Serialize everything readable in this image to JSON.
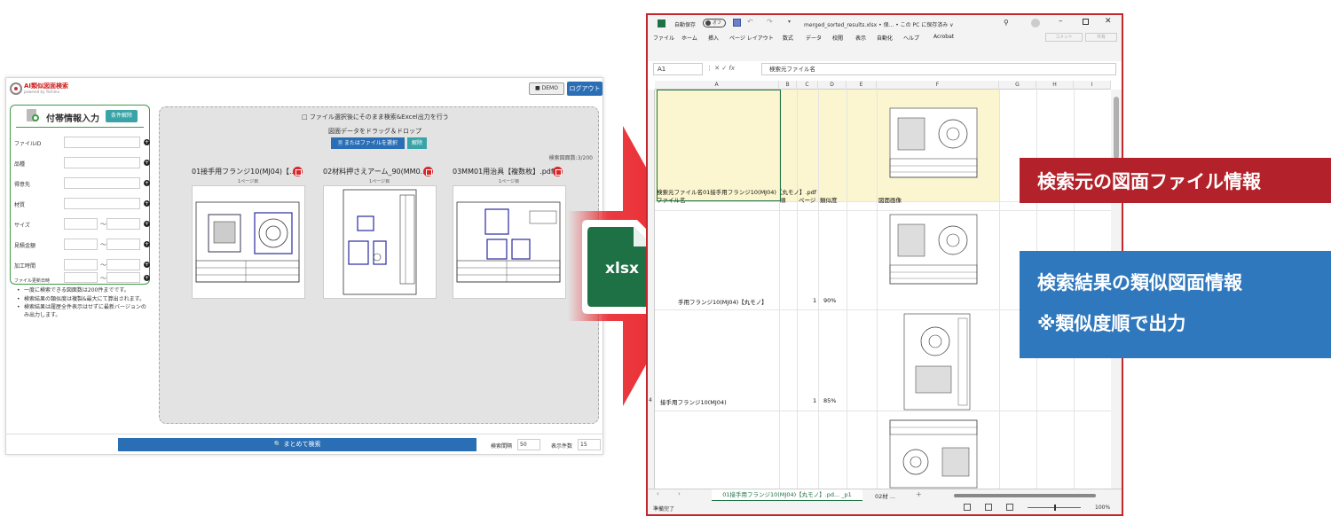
{
  "app": {
    "title": "AI類似図面検索",
    "subtitle": "powered by Techmo",
    "demo_label": "DEMO",
    "logout_label": "ログアウト"
  },
  "side": {
    "title": "付帯情報入力",
    "reset_label": "条件解除",
    "fields": [
      "ファイルID",
      "品種",
      "得意先",
      "材質",
      "サイズ",
      "見積金額",
      "加工時間",
      "ファイル更新日時"
    ],
    "range_tilde": "〜"
  },
  "notes": [
    "一度に検索できる図面数は200件までです。",
    "検索結果の類似度は複製&最大にて算出されます。",
    "検索結果は履歴全件表示はせずに最新バージョンのみ出力します。"
  ],
  "drop": {
    "auto_check_label": "ファイル選択後にそのまま検索&Excel出力を行う",
    "drop_text": "図面データをドラッグ＆ドロップ",
    "select_label": "またはファイルを選択",
    "clear_label": "解除",
    "count_text": "検索図面数:3/200",
    "page_label": "1ページ目",
    "cards": [
      {
        "title": "01接手用フランジ10(MJ04)【..."
      },
      {
        "title": "02材料押さえアーム_90(MM0..."
      },
      {
        "title": "03MM01用治具【複数枚】.pdf"
      }
    ]
  },
  "bottom": {
    "search_all_label": "まとめて検索",
    "interval_label": "検索間隔",
    "interval_value": "50",
    "display_label": "表示件数",
    "display_value": "15"
  },
  "badge": {
    "label": "xlsx"
  },
  "excel": {
    "autosave_label": "自動保存",
    "autosave_state": "オフ",
    "file_title": "merged_sorted_results.xlsx • 保... • この PC に保存済み ∨",
    "menu": [
      "ファイル",
      "ホーム",
      "挿入",
      "ページ レイアウト",
      "数式",
      "データ",
      "校閲",
      "表示",
      "自動化",
      "ヘルプ",
      "Acrobat"
    ],
    "comment_label": "コメント",
    "share_label": "共有",
    "name_box": "A1",
    "fx_label": "fx",
    "formula": "検索元ファイル名",
    "columns": [
      "A",
      "B",
      "C",
      "D",
      "E",
      "F",
      "G",
      "H",
      "I"
    ],
    "row1_text": "検索元ファイル名01接手用フランジ10(MJ04)【丸モノ】.pdf",
    "row2_headers": [
      "ファイル名",
      "順",
      "ページ",
      "類似度",
      "図面画像"
    ],
    "row3": {
      "name": "手用フランジ10(MJ04)【丸モノ】",
      "page": "1",
      "similarity": "90%"
    },
    "row4": {
      "index": "4",
      "name": "接手用フランジ10(MJ04)",
      "page": "1",
      "similarity": "85%"
    },
    "sheet_tab_1": "01接手用フランジ10(MJ04)【丸モノ】.pd... _p1",
    "sheet_tab_2": "02材 ...",
    "status": "準備完了",
    "zoom": "100%"
  },
  "callouts": {
    "red": "検索元の図面ファイル情報",
    "blue1": "検索結果の類似図面情報",
    "blue2": "※類似度順で出力"
  },
  "colors": {
    "red_accent": "#b3222a",
    "blue_accent": "#2f78bd",
    "excel_green": "#1e7145",
    "app_blue": "#2a6fb5"
  }
}
